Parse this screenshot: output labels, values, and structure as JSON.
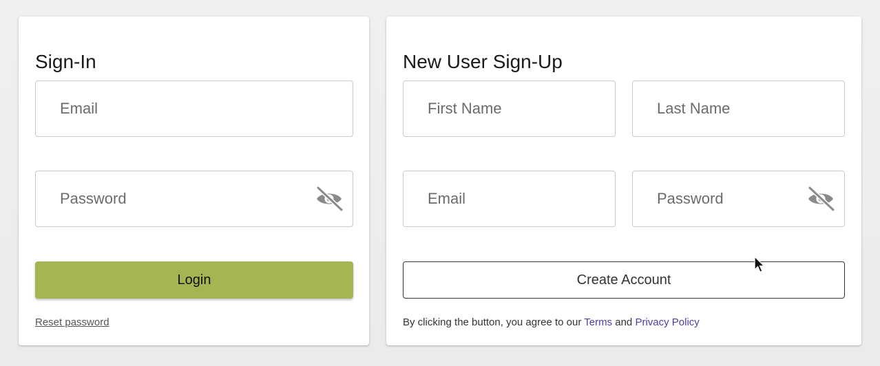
{
  "signin": {
    "title": "Sign-In",
    "email_placeholder": "Email",
    "password_placeholder": "Password",
    "login_label": "Login",
    "reset_label": "Reset password"
  },
  "signup": {
    "title": "New User Sign-Up",
    "first_name_placeholder": "First Name",
    "last_name_placeholder": "Last Name",
    "email_placeholder": "Email",
    "password_placeholder": "Password",
    "create_label": "Create Account",
    "terms_prefix": "By clicking the button, you agree to our",
    "terms_link": "Terms",
    "terms_and": "and",
    "privacy_link": "Privacy Policy"
  },
  "icons": {
    "password_toggle": "eye-slash-icon",
    "pointer": "mouse-cursor-icon"
  },
  "colors": {
    "login_button": "#a5b553",
    "link": "#4a3fa8",
    "background": "#eceeef"
  }
}
